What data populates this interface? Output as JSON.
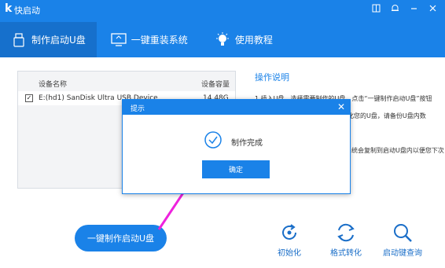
{
  "app": {
    "logo": "k",
    "title": "快启动"
  },
  "window_icons": [
    "book-icon",
    "bell-icon",
    "minimize-icon",
    "close-icon"
  ],
  "tabs": [
    {
      "label": "制作启动U盘",
      "icon": "usb-icon",
      "active": true
    },
    {
      "label": "一键重装系统",
      "icon": "monitor-icon",
      "active": false
    },
    {
      "label": "使用教程",
      "icon": "lightbulb-icon",
      "active": false
    }
  ],
  "device_table": {
    "headers": {
      "name": "设备名称",
      "size": "设备容量"
    },
    "rows": [
      {
        "checked": true,
        "name": "E:(hd1) SanDisk Ultra USB Device",
        "size": "14.48G"
      }
    ]
  },
  "help": {
    "title": "操作说明",
    "lines": [
      "1.插入U盘，选择需要制作的U盘，点击“一键制作启动U盘”按钮",
      "式化您的U盘，请备份U盘内数",
      "",
      "系统会复制到启动U盘内以便您下次"
    ]
  },
  "main_button": "一键制作启动U盘",
  "tools": [
    {
      "label": "初始化",
      "icon": "refresh-icon"
    },
    {
      "label": "格式转化",
      "icon": "convert-icon"
    },
    {
      "label": "启动键查询",
      "icon": "search-icon"
    }
  ],
  "dialog": {
    "title": "提示",
    "message": "制作完成",
    "ok": "确定"
  },
  "colors": {
    "brand": "#1a82e8",
    "arrow": "#ee22dd"
  }
}
